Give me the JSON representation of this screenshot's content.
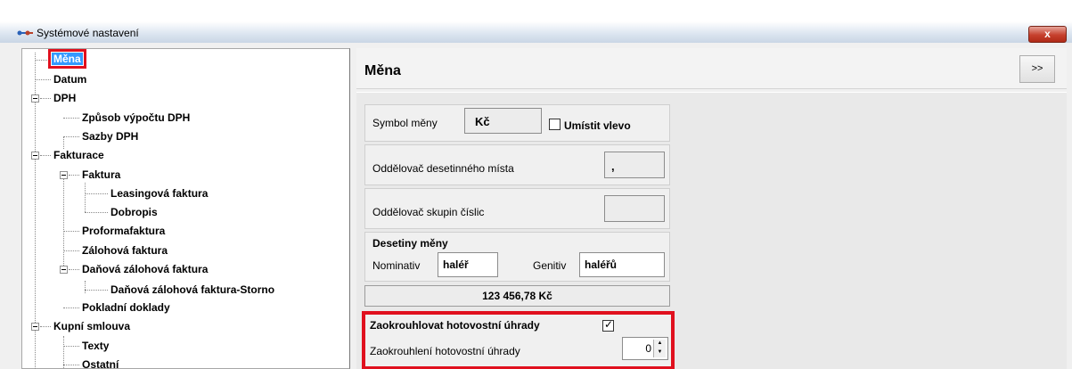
{
  "window": {
    "title": "Systémové nastavení",
    "close_label": "x"
  },
  "tree": {
    "items": [
      {
        "label": "Měna",
        "level": 1,
        "selected": true
      },
      {
        "label": "Datum",
        "level": 1
      },
      {
        "label": "DPH",
        "level": 1,
        "expanded": true
      },
      {
        "label": "Způsob výpočtu DPH",
        "level": 2
      },
      {
        "label": "Sazby DPH",
        "level": 2
      },
      {
        "label": "Fakturace",
        "level": 1,
        "expanded": true
      },
      {
        "label": "Faktura",
        "level": 2,
        "expanded": true
      },
      {
        "label": "Leasingová faktura",
        "level": 3
      },
      {
        "label": "Dobropis",
        "level": 3
      },
      {
        "label": "Proformafaktura",
        "level": 2
      },
      {
        "label": "Zálohová faktura",
        "level": 2
      },
      {
        "label": "Daňová zálohová faktura",
        "level": 2,
        "expanded": true
      },
      {
        "label": "Daňová zálohová faktura-Storno",
        "level": 3
      },
      {
        "label": "Pokladní doklady",
        "level": 2
      },
      {
        "label": "Kupní smlouva",
        "level": 1,
        "expanded": true
      },
      {
        "label": "Texty",
        "level": 2
      },
      {
        "label": "Ostatní",
        "level": 2
      }
    ]
  },
  "header": {
    "title": "Měna",
    "expand_label": ">>"
  },
  "currency": {
    "symbol_label": "Symbol měny",
    "symbol_value": "Kč",
    "place_left_label": "Umístit vlevo",
    "place_left_checked": false,
    "decimal_sep_label": "Oddělovač desetinného místa",
    "decimal_sep_value": ",",
    "group_sep_label": "Oddělovač skupin číslic",
    "group_sep_value": "",
    "decimals_title": "Desetiny měny",
    "nominativ_label": "Nominativ",
    "nominativ_value": "haléř",
    "genitiv_label": "Genitiv",
    "genitiv_value": "haléřů",
    "preview": "123 456,78 Kč",
    "round_cash_label": "Zaokrouhlovat hotovostní úhrady",
    "round_cash_checked": true,
    "round_amount_label": "Zaokrouhlení hotovostní úhrady",
    "round_amount_value": "0"
  },
  "colors": {
    "selection": "#3399ff",
    "highlight": "#e0101e",
    "close": "#c6402d"
  }
}
